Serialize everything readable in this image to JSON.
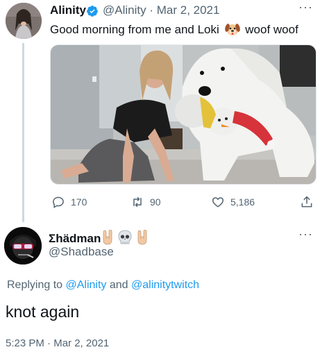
{
  "tweet1": {
    "author_name": "Alinity",
    "handle": "@Alinity",
    "date_sep": "·",
    "date": "Mar 2, 2021",
    "text_before": "Good morning from me and Loki",
    "text_after": "woof woof",
    "emoji": "dog-face",
    "more": "···",
    "actions": {
      "replies": "170",
      "retweets": "90",
      "likes": "5,186"
    }
  },
  "tweet2": {
    "author_name": "Σhädman",
    "handle": "@Shadbase",
    "emojis": [
      "sign-of-horns",
      "skull",
      "sign-of-horns"
    ],
    "more": "···",
    "replying_prefix": "Replying to",
    "replying_to_1": "@Alinity",
    "replying_and": "and",
    "replying_to_2": "@alinitytwitch",
    "text": "knot again",
    "time": "5:23 PM",
    "date_sep": "·",
    "date": "Mar 2, 2021"
  },
  "colors": {
    "link": "#1d9bf0",
    "secondary_text": "#536471",
    "verified": "#1d9bf0",
    "thread_line": "#cfd9de"
  }
}
